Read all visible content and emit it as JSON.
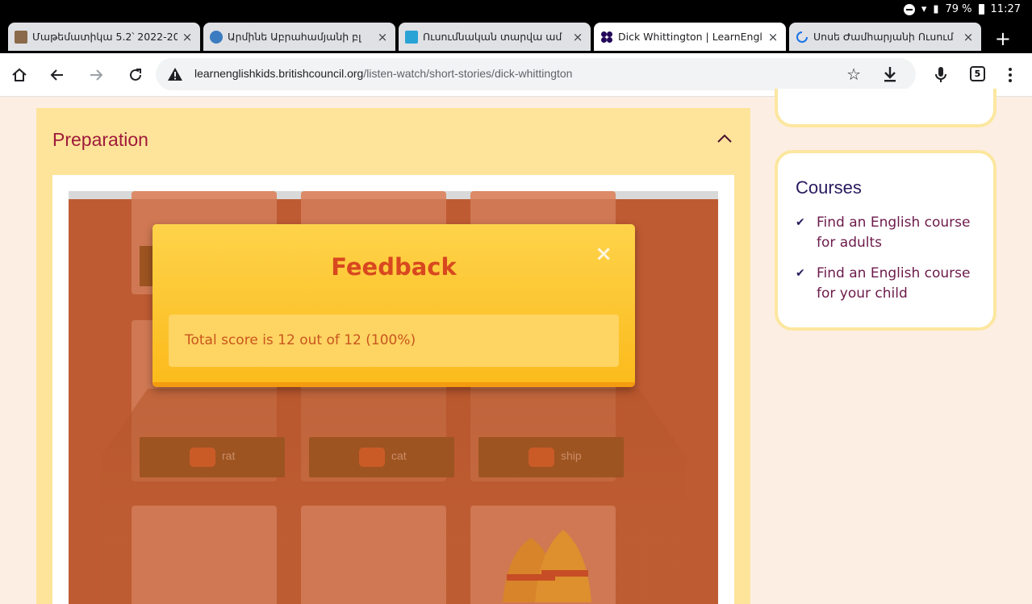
{
  "status_bar": {
    "battery": "79 %",
    "time": "11:27"
  },
  "tabs": [
    {
      "title": "Մաթեմատիկա 5.2՝ 2022-20",
      "active": false
    },
    {
      "title": "Արմինե Աբրահամյանի բլ",
      "active": false
    },
    {
      "title": "Ուսումնական տարվա ամ",
      "active": false
    },
    {
      "title": "Dick Whittington | LearnEnglish K",
      "active": true
    },
    {
      "title": "Սոսե Ժամհարյանի Ուսում",
      "active": false
    }
  ],
  "toolbar": {
    "url_domain": "learnenglishkids.britishcouncil.org",
    "url_path": "/listen-watch/short-stories/dick-whittington",
    "tab_count": "5"
  },
  "page": {
    "section_title": "Preparation",
    "words": [
      "rat",
      "cat",
      "ship"
    ],
    "modal": {
      "title": "Feedback",
      "close": "×",
      "message": "Total score is 12 out of 12 (100%)"
    },
    "sidebar": {
      "courses_title": "Courses",
      "items": [
        "Find an English course for adults",
        "Find an English course for your child"
      ]
    }
  },
  "icons": {
    "tab_close": "×",
    "new_tab": "+",
    "check": "✔"
  }
}
